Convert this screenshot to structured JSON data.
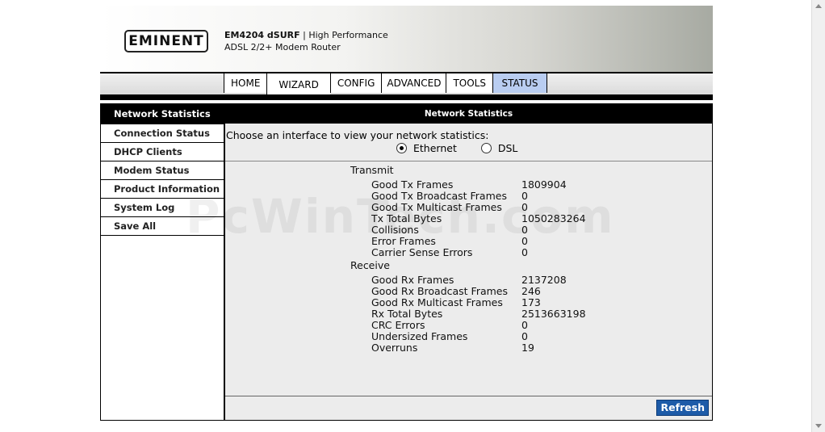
{
  "brand": {
    "logo": "EMINENT",
    "model": "EM4204 dSURF",
    "tagline_1": "| High Performance",
    "tagline_2": "ADSL 2/2+ Modem Router"
  },
  "nav": {
    "tabs": [
      {
        "label": "HOME"
      },
      {
        "label": "WIZARD"
      },
      {
        "label": "CONFIG"
      },
      {
        "label": "ADVANCED"
      },
      {
        "label": "TOOLS"
      },
      {
        "label": "STATUS",
        "active": true
      }
    ]
  },
  "sidebar": {
    "items": [
      {
        "label": "Network Statistics",
        "active": true
      },
      {
        "label": "Connection Status"
      },
      {
        "label": "DHCP Clients"
      },
      {
        "label": "Modem Status"
      },
      {
        "label": "Product Information"
      },
      {
        "label": "System Log"
      },
      {
        "label": "Save All"
      }
    ]
  },
  "main": {
    "title": "Network Statistics",
    "prompt": "Choose an interface to view your network statistics:",
    "interfaces": [
      {
        "label": "Ethernet",
        "selected": true
      },
      {
        "label": "DSL",
        "selected": false
      }
    ],
    "transmit": {
      "heading": "Transmit",
      "rows": [
        {
          "label": "Good Tx Frames",
          "value": "1809904"
        },
        {
          "label": "Good Tx Broadcast Frames",
          "value": "0"
        },
        {
          "label": "Good Tx Multicast Frames",
          "value": "0"
        },
        {
          "label": "Tx Total Bytes",
          "value": "1050283264"
        },
        {
          "label": "Collisions",
          "value": "0"
        },
        {
          "label": "Error Frames",
          "value": "0"
        },
        {
          "label": "Carrier Sense Errors",
          "value": "0"
        }
      ]
    },
    "receive": {
      "heading": "Receive",
      "rows": [
        {
          "label": "Good Rx Frames",
          "value": "2137208"
        },
        {
          "label": "Good Rx Broadcast Frames",
          "value": "246"
        },
        {
          "label": "Good Rx Multicast Frames",
          "value": "173"
        },
        {
          "label": "Rx Total Bytes",
          "value": "2513663198"
        },
        {
          "label": "CRC Errors",
          "value": "0"
        },
        {
          "label": "Undersized Frames",
          "value": "0"
        },
        {
          "label": "Overruns",
          "value": "19"
        }
      ]
    },
    "refresh_label": "Refresh"
  },
  "watermark": "PcWinTech.com",
  "colors": {
    "active_tab": "#b9cdf1",
    "refresh_button": "#1d5ba8"
  }
}
